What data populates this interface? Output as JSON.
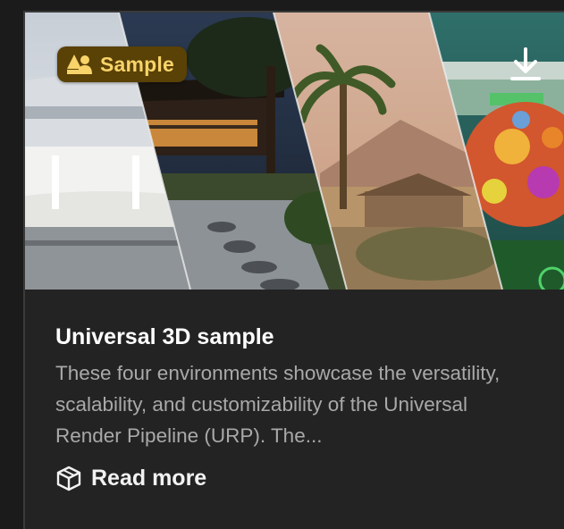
{
  "card": {
    "badge_label": "Sample",
    "title": "Universal 3D sample",
    "description": "These four environments showcase the versatility, scalability, and customizability of the Universal Render Pipeline (URP). The...",
    "read_more_label": "Read more"
  },
  "icons": {
    "badge": "person-badge-icon",
    "download": "download-icon",
    "read_more": "box-cube-icon"
  },
  "colors": {
    "badge_bg": "#5a4106",
    "badge_text": "#f7d36a",
    "card_bg": "#232323",
    "title": "#ffffff",
    "description": "#a9a9a9"
  }
}
